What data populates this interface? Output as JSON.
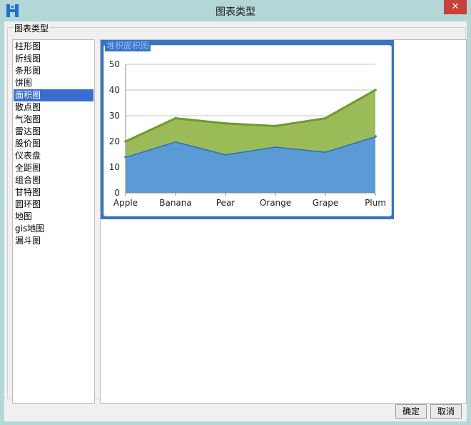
{
  "window": {
    "title": "图表类型",
    "close_glyph": "✕"
  },
  "group": {
    "legend": "图表类型"
  },
  "chart_types": [
    {
      "label": "柱形图"
    },
    {
      "label": "折线图"
    },
    {
      "label": "条形图"
    },
    {
      "label": "饼图"
    },
    {
      "label": "面积图",
      "selected": true
    },
    {
      "label": "散点图"
    },
    {
      "label": "气泡图"
    },
    {
      "label": "雷达图"
    },
    {
      "label": "股价图"
    },
    {
      "label": "仪表盘"
    },
    {
      "label": "全距图"
    },
    {
      "label": "组合图"
    },
    {
      "label": "甘特图"
    },
    {
      "label": "圆环图"
    },
    {
      "label": "地图"
    },
    {
      "label": "gis地图"
    },
    {
      "label": "漏斗图"
    }
  ],
  "preview": {
    "label": "堆积面积图"
  },
  "chart_data": {
    "type": "area",
    "stacked": true,
    "categories": [
      "Apple",
      "Banana",
      "Pear",
      "Orange",
      "Grape",
      "Plum"
    ],
    "series": [
      {
        "values": [
          14,
          20,
          15,
          18,
          16,
          22
        ],
        "color": "#5b9bd5",
        "line": "#2a6ebe"
      },
      {
        "values": [
          6,
          9,
          12,
          8,
          13,
          18
        ],
        "color": "#9bbb59",
        "line": "#6f9a2e"
      }
    ],
    "ylim": [
      0,
      50
    ],
    "yticks": [
      0,
      10,
      20,
      30,
      40,
      50
    ],
    "grid": true
  },
  "buttons": {
    "ok": "确定",
    "cancel": "取消"
  }
}
